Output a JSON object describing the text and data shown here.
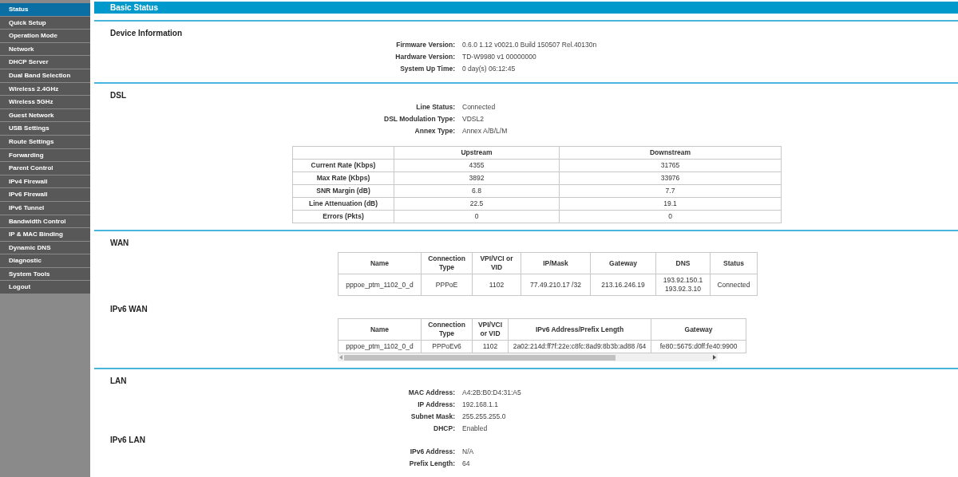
{
  "sidebar": {
    "items": [
      {
        "label": "Status",
        "selected": true
      },
      {
        "label": "Quick Setup",
        "selected": false
      },
      {
        "label": "Operation Mode",
        "selected": false
      },
      {
        "label": "Network",
        "selected": false
      },
      {
        "label": "DHCP Server",
        "selected": false
      },
      {
        "label": "Dual Band Selection",
        "selected": false
      },
      {
        "label": "Wireless 2.4GHz",
        "selected": false
      },
      {
        "label": "Wireless 5GHz",
        "selected": false
      },
      {
        "label": "Guest Network",
        "selected": false
      },
      {
        "label": "USB Settings",
        "selected": false
      },
      {
        "label": "Route Settings",
        "selected": false
      },
      {
        "label": "Forwarding",
        "selected": false
      },
      {
        "label": "Parent Control",
        "selected": false
      },
      {
        "label": "IPv4 Firewall",
        "selected": false
      },
      {
        "label": "IPv6 Firewall",
        "selected": false
      },
      {
        "label": "IPv6 Tunnel",
        "selected": false
      },
      {
        "label": "Bandwidth Control",
        "selected": false
      },
      {
        "label": "IP & MAC Binding",
        "selected": false
      },
      {
        "label": "Dynamic DNS",
        "selected": false
      },
      {
        "label": "Diagnostic",
        "selected": false
      },
      {
        "label": "System Tools",
        "selected": false
      },
      {
        "label": "Logout",
        "selected": false
      }
    ]
  },
  "header": {
    "title": "Basic Status"
  },
  "groups": [
    {
      "sections": [
        {
          "title": "Device Information",
          "fields": [
            {
              "label": "Firmware Version:",
              "value": "0.6.0 1.12 v0021.0 Build 150507 Rel.40130n"
            },
            {
              "label": "Hardware Version:",
              "value": "TD-W9980 v1 00000000"
            },
            {
              "label": "System Up Time:",
              "value": "0 day(s) 06:12:45"
            }
          ]
        }
      ]
    },
    {
      "sections": [
        {
          "title": "DSL",
          "fields": [
            {
              "label": "Line Status:",
              "value": "Connected"
            },
            {
              "label": "DSL Modulation Type:",
              "value": "VDSL2"
            },
            {
              "label": "Annex Type:",
              "value": "Annex A/B/L/M"
            }
          ],
          "table": {
            "kind": "stats",
            "columns": [
              "Upstream",
              "Downstream"
            ],
            "rows": [
              {
                "label": "Current Rate (Kbps)",
                "cells": [
                  "4355",
                  "31765"
                ]
              },
              {
                "label": "Max Rate (Kbps)",
                "cells": [
                  "3892",
                  "33976"
                ]
              },
              {
                "label": "SNR Margin (dB)",
                "cells": [
                  "6.8",
                  "7.7"
                ]
              },
              {
                "label": "Line Attenuation (dB)",
                "cells": [
                  "22.5",
                  "19.1"
                ]
              },
              {
                "label": "Errors (Pkts)",
                "cells": [
                  "0",
                  "0"
                ]
              }
            ]
          }
        }
      ]
    },
    {
      "sections": [
        {
          "title": "WAN",
          "table": {
            "kind": "wan",
            "columns": [
              "Name",
              "Connection Type",
              "VPI/VCI or VID",
              "IP/Mask",
              "Gateway",
              "DNS",
              "Status"
            ],
            "rows": [
              {
                "cells": [
                  "pppoe_ptm_1102_0_d",
                  "PPPoE",
                  "1102",
                  "77.49.210.17 /32",
                  "213.16.246.19",
                  "193.92.150.1\n193.92.3.10",
                  "Connected"
                ]
              }
            ]
          }
        },
        {
          "title": "IPv6 WAN",
          "table": {
            "kind": "wan6",
            "columns": [
              "Name",
              "Connection Type",
              "VPI/VCI or VID",
              "IPv6 Address/Prefix Length",
              "Gateway"
            ],
            "rows": [
              {
                "cells": [
                  "pppoe_ptm_1102_0_d",
                  "PPPoEv6",
                  "1102",
                  "2a02:214d:ff7f:22e:c8fc:8ad9:8b3b:ad88 /64",
                  "fe80::5675:d0ff:fe40:9900"
                ]
              }
            ]
          }
        }
      ]
    },
    {
      "sections": [
        {
          "title": "LAN",
          "fields": [
            {
              "label": "MAC Address:",
              "value": "A4:2B:B0:D4:31:A5"
            },
            {
              "label": "IP Address:",
              "value": "192.168.1.1"
            },
            {
              "label": "Subnet Mask:",
              "value": "255.255.255.0"
            },
            {
              "label": "DHCP:",
              "value": "Enabled"
            }
          ]
        },
        {
          "title": "IPv6 LAN",
          "fields": [
            {
              "label": "IPv6 Address:",
              "value": "N/A"
            },
            {
              "label": "Prefix Length:",
              "value": "64"
            }
          ]
        }
      ]
    }
  ]
}
